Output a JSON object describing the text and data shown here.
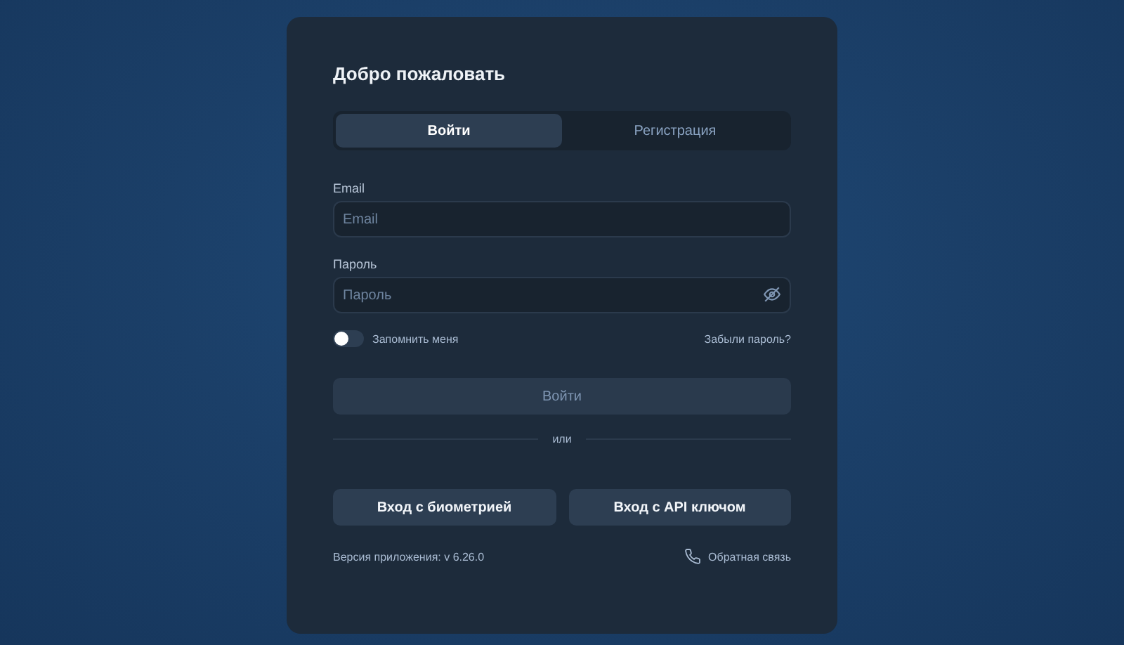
{
  "title": "Добро пожаловать",
  "tabs": [
    {
      "label": "Войти",
      "selected": true
    },
    {
      "label": "Регистрация",
      "selected": false
    }
  ],
  "fields": [
    {
      "label": "Email",
      "placeholder": "Email",
      "kind": "text"
    },
    {
      "label": "Пароль",
      "placeholder": "Пароль",
      "kind": "password"
    }
  ],
  "remember": {
    "label": "Запомнить меня",
    "on": false
  },
  "forgot_link": "Забыли пароль?",
  "submit": {
    "label": "Войти",
    "disabled": true
  },
  "divider_text": "или",
  "alt_buttons": [
    "Вход с биометрией",
    "Вход с API ключом"
  ],
  "version": "Версия приложения: v 6.26.0",
  "feedback_link": "Обратная связь"
}
